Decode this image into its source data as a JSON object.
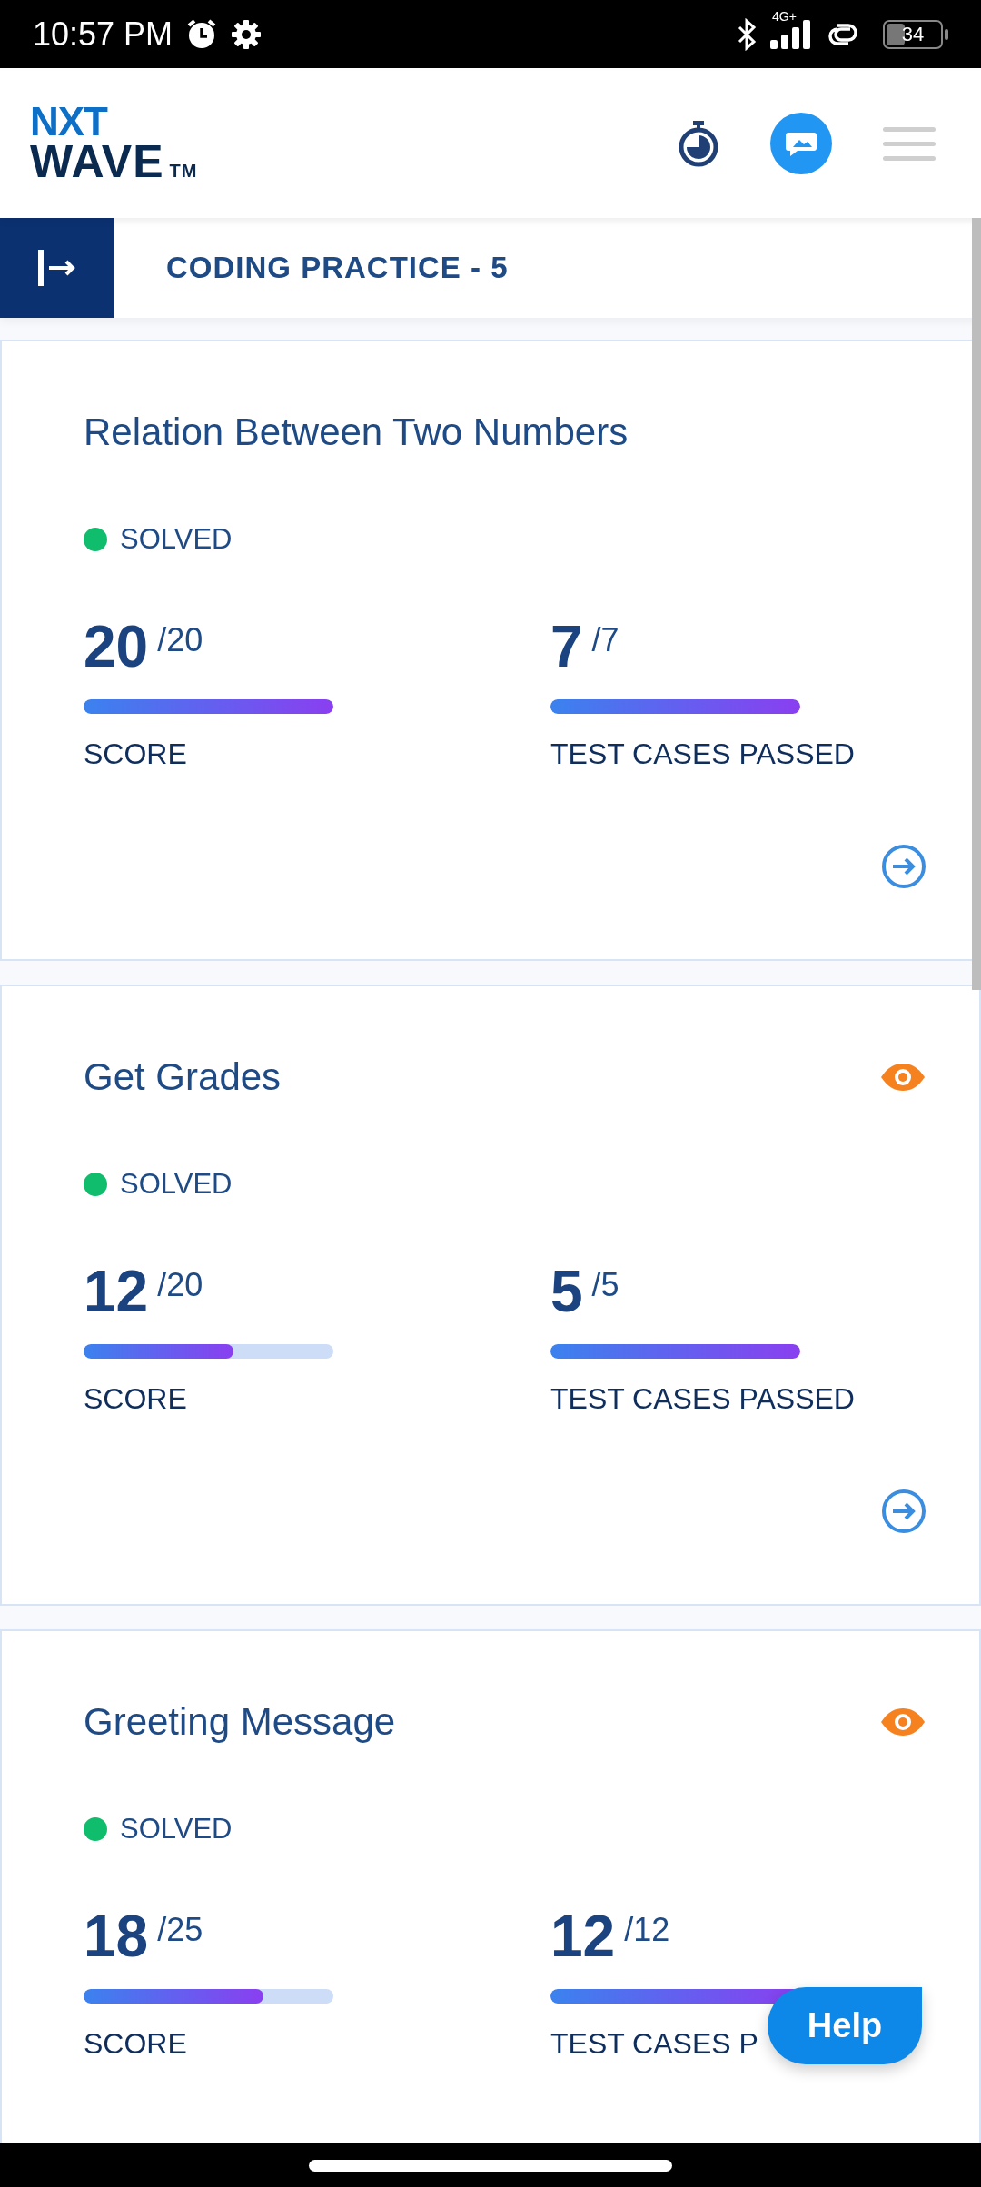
{
  "status_bar": {
    "time": "10:57 PM",
    "network": "4G+",
    "battery": "34"
  },
  "header": {
    "logo": {
      "line_1": "NXT",
      "line_2": "WAVE",
      "mark": "TM"
    }
  },
  "practice_bar": {
    "title": "CODING PRACTICE - 5"
  },
  "questions": [
    {
      "title": "Relation Between Two Numbers",
      "viewed": false,
      "status": {
        "label": "SOLVED",
        "color": "#0fbd6c"
      },
      "score": {
        "value": "20",
        "total": "/20",
        "level": 1.0,
        "label": "SCORE"
      },
      "test_cases": {
        "value": "7",
        "total": "/7",
        "level": 1.0,
        "label": "TEST CASES PASSED"
      }
    },
    {
      "title": "Get Grades",
      "viewed": true,
      "status": {
        "label": "SOLVED",
        "color": "#0fbd6c"
      },
      "score": {
        "value": "12",
        "total": "/20",
        "level": 0.6,
        "label": "SCORE"
      },
      "test_cases": {
        "value": "5",
        "total": "/5",
        "level": 1.0,
        "label": "TEST CASES PASSED"
      }
    },
    {
      "title": "Greeting Message",
      "viewed": true,
      "status": {
        "label": "SOLVED",
        "color": "#0fbd6c"
      },
      "score": {
        "value": "18",
        "total": "/25",
        "level": 0.72,
        "label": "SCORE"
      },
      "test_cases": {
        "value": "12",
        "total": "/12",
        "level": 1.0,
        "label": "TEST CASES P"
      }
    }
  ],
  "help_button": {
    "label": "Help"
  }
}
